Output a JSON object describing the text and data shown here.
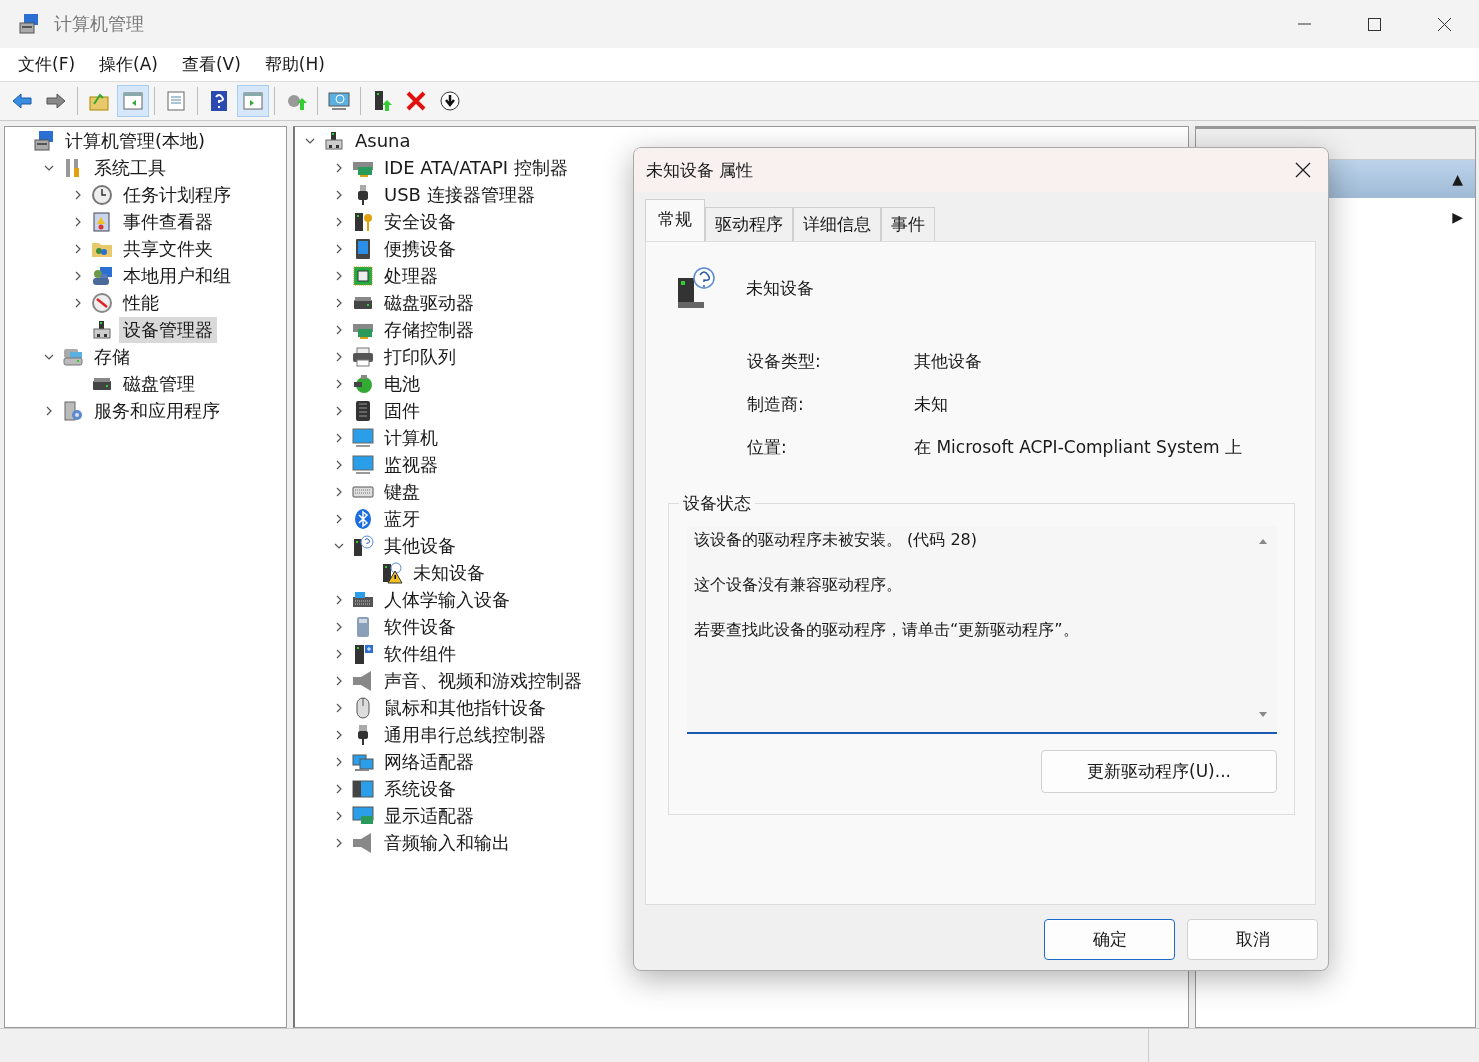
{
  "window": {
    "title": "计算机管理"
  },
  "menu": [
    {
      "label": "文件(F)"
    },
    {
      "label": "操作(A)"
    },
    {
      "label": "查看(V)"
    },
    {
      "label": "帮助(H)"
    }
  ],
  "toolbar": [
    {
      "kind": "back",
      "pressed": false
    },
    {
      "kind": "forward",
      "pressed": false
    },
    {
      "kind": "separator"
    },
    {
      "kind": "up",
      "pressed": false
    },
    {
      "kind": "tree",
      "pressed": true
    },
    {
      "kind": "separator"
    },
    {
      "kind": "properties",
      "pressed": false
    },
    {
      "kind": "separator"
    },
    {
      "kind": "help",
      "pressed": false
    },
    {
      "kind": "pane",
      "pressed": true
    },
    {
      "kind": "separator"
    },
    {
      "kind": "update",
      "pressed": false
    },
    {
      "kind": "separator"
    },
    {
      "kind": "scan",
      "pressed": false
    },
    {
      "kind": "separator"
    },
    {
      "kind": "enable",
      "pressed": false
    },
    {
      "kind": "remove",
      "pressed": false
    },
    {
      "kind": "download",
      "pressed": false
    }
  ],
  "console_tree": [
    {
      "label": "计算机管理(本地)",
      "selected": false,
      "children": [
        {
          "label": "系统工具",
          "expanded": true,
          "selected": false,
          "children": [
            {
              "label": "任务计划程序",
              "expanded": false,
              "selected": false
            },
            {
              "label": "事件查看器",
              "expanded": false,
              "selected": false
            },
            {
              "label": "共享文件夹",
              "expanded": false,
              "selected": false
            },
            {
              "label": "本地用户和组",
              "expanded": false,
              "selected": false
            },
            {
              "label": "性能",
              "expanded": false,
              "selected": false
            },
            {
              "label": "设备管理器",
              "selected": true
            }
          ]
        },
        {
          "label": "存储",
          "expanded": true,
          "selected": false,
          "children": [
            {
              "label": "磁盘管理",
              "selected": false
            }
          ]
        },
        {
          "label": "服务和应用程序",
          "expanded": false,
          "selected": false
        }
      ]
    }
  ],
  "device_tree": [
    {
      "label": "Asuna",
      "expanded": true,
      "children": [
        {
          "label": "IDE ATA/ATAPI 控制器",
          "expanded": false
        },
        {
          "label": "USB 连接器管理器",
          "expanded": false
        },
        {
          "label": "安全设备",
          "expanded": false
        },
        {
          "label": "便携设备",
          "expanded": false
        },
        {
          "label": "处理器",
          "expanded": false
        },
        {
          "label": "磁盘驱动器",
          "expanded": false
        },
        {
          "label": "存储控制器",
          "expanded": false
        },
        {
          "label": "打印队列",
          "expanded": false
        },
        {
          "label": "电池",
          "expanded": false
        },
        {
          "label": "固件",
          "expanded": false
        },
        {
          "label": "计算机",
          "expanded": false
        },
        {
          "label": "监视器",
          "expanded": false
        },
        {
          "label": "键盘",
          "expanded": false
        },
        {
          "label": "蓝牙",
          "expanded": false
        },
        {
          "label": "其他设备",
          "expanded": true,
          "children": [
            {
              "label": "未知设备"
            }
          ]
        },
        {
          "label": "人体学输入设备",
          "expanded": false
        },
        {
          "label": "软件设备",
          "expanded": false
        },
        {
          "label": "软件组件",
          "expanded": false
        },
        {
          "label": "声音、视频和游戏控制器",
          "expanded": false
        },
        {
          "label": "鼠标和其他指针设备",
          "expanded": false
        },
        {
          "label": "通用串行总线控制器",
          "expanded": false
        },
        {
          "label": "网络适配器",
          "expanded": false
        },
        {
          "label": "系统设备",
          "expanded": false
        },
        {
          "label": "显示适配器",
          "expanded": false
        },
        {
          "label": "音频输入和输出",
          "expanded": false
        }
      ]
    }
  ],
  "actions_pane": {
    "rows": [
      {
        "arrow": "▲",
        "selected": true
      },
      {
        "arrow": "▶",
        "selected": false
      }
    ]
  },
  "dialog": {
    "title": "未知设备 属性",
    "tabs": [
      {
        "label": "常规",
        "selected": true
      },
      {
        "label": "驱动程序",
        "selected": false
      },
      {
        "label": "详细信息",
        "selected": false
      },
      {
        "label": "事件",
        "selected": false
      }
    ],
    "device_name": "未知设备",
    "properties": [
      {
        "label": "设备类型:",
        "value": "其他设备"
      },
      {
        "label": "制造商:",
        "value": "未知"
      },
      {
        "label": "位置:",
        "value": "在 Microsoft ACPI-Compliant System 上"
      }
    ],
    "status_group": {
      "title": "设备状态",
      "lines": [
        "该设备的驱动程序未被安装。 (代码 28)",
        "这个设备没有兼容驱动程序。",
        "若要查找此设备的驱动程序，请单击“更新驱动程序”。"
      ],
      "button": "更新驱动程序(U)..."
    },
    "buttons": [
      {
        "label": "确定",
        "default": true
      },
      {
        "label": "取消",
        "default": false
      }
    ]
  }
}
